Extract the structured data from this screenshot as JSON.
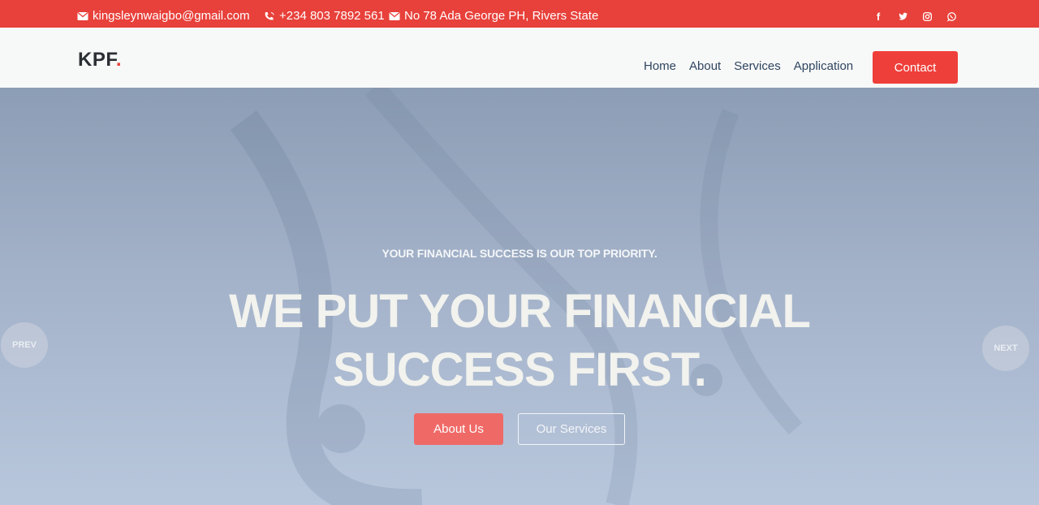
{
  "topbar": {
    "email": "kingsleynwaigbo@gmail.com",
    "phone": "+234 803 7892 561",
    "address": "No 78 Ada George PH, Rivers State",
    "social": [
      "facebook-icon",
      "twitter-icon",
      "instagram-icon",
      "whatsapp-icon"
    ]
  },
  "header": {
    "logo": "KPF",
    "logo_dot": ".",
    "nav": [
      "Home",
      "About",
      "Services",
      "Application"
    ],
    "contact_label": "Contact"
  },
  "hero": {
    "subtitle": "YOUR FINANCIAL SUCCESS IS OUR TOP PRIORITY.",
    "title": "WE PUT YOUR FINANCIAL SUCCESS FIRST.",
    "about_button": "About Us",
    "services_button": "Our Services",
    "prev_label": "PREV",
    "next_label": "NEXT"
  },
  "colors": {
    "accent": "#e8403a",
    "hero_top": "#8c9db5",
    "hero_bottom": "#b8c7dc"
  }
}
